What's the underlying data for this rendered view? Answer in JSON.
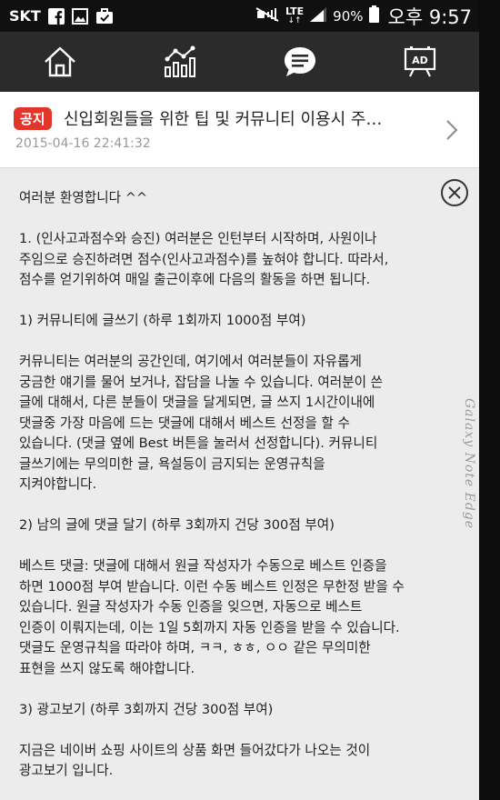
{
  "statusbar": {
    "carrier": "SKT",
    "network": "LTE",
    "battery": "90%",
    "clock": "오후 9:57"
  },
  "nav": {
    "items": [
      "home-icon",
      "chart-icon",
      "community-chat-icon",
      "ad-billboard-icon"
    ],
    "ad_text": "AD",
    "active": "community-chat-icon"
  },
  "post": {
    "badge": "공지",
    "title": "신입회원들을 위한 팁 및 커뮤니티 이용시 주…",
    "date": "2015-04-16 22:41:32"
  },
  "content": {
    "paragraphs": [
      "여러분 환영합니다 ^^",
      "1. (인사고과점수와 승진) 여러분은 인턴부터 시작하며, 사원이나\n주임으로 승진하려면 점수(인사고과점수)를 높혀야 합니다. 따라서,\n점수를 얻기위하여 매일 출근이후에 다음의 활동을 하면 됩니다.",
      "1) 커뮤니티에 글쓰기 (하루 1회까지 1000점 부여)",
      "커뮤니티는 여러분의 공간인데, 여기에서 여러분들이 자유롭게\n궁금한 얘기를 물어 보거나, 잡담을 나눌 수 있습니다. 여러분이 쓴\n글에 대해서, 다른 분들이 댓글을 달게되면, 글 쓰지 1시간이내에\n댓글중 가장 마음에 드는 댓글에 대해서 베스트 선정을 할 수\n있습니다. (댓글 옆에 Best 버튼을 눌러서 선정합니다). 커뮤니티\n글쓰기에는 무의미한 글, 욕설등이 금지되는 운영규칙을\n지켜야합니다.",
      "2) 남의 글에 댓글 달기 (하루 3회까지 건당 300점 부여)",
      "베스트 댓글: 댓글에 대해서 원글 작성자가 수동으로 베스트 인증을\n하면 1000점 부여 받습니다. 이런 수동 베스트 인정은 무한정 받을 수\n있습니다. 원글 작성자가 수동 인증을 잊으면, 자동으로 베스트\n인증이 이뤄지는데, 이는 1일 5회까지 자동 인증을 받을 수 있습니다.\n댓글도 운영규칙을 따라야 하며, ㅋㅋ, ㅎㅎ, ㅇㅇ 같은 무의미한\n표현을 쓰지 않도록 해야합니다.",
      "3) 광고보기 (하루 3회까지 건당 300점 부여)",
      "지금은 네이버 쇼핑 사이트의 상품 화면 들어갔다가 나오는 것이\n광고보기 입니다."
    ]
  },
  "device": {
    "edge_label": "Galaxy Note Edge"
  }
}
